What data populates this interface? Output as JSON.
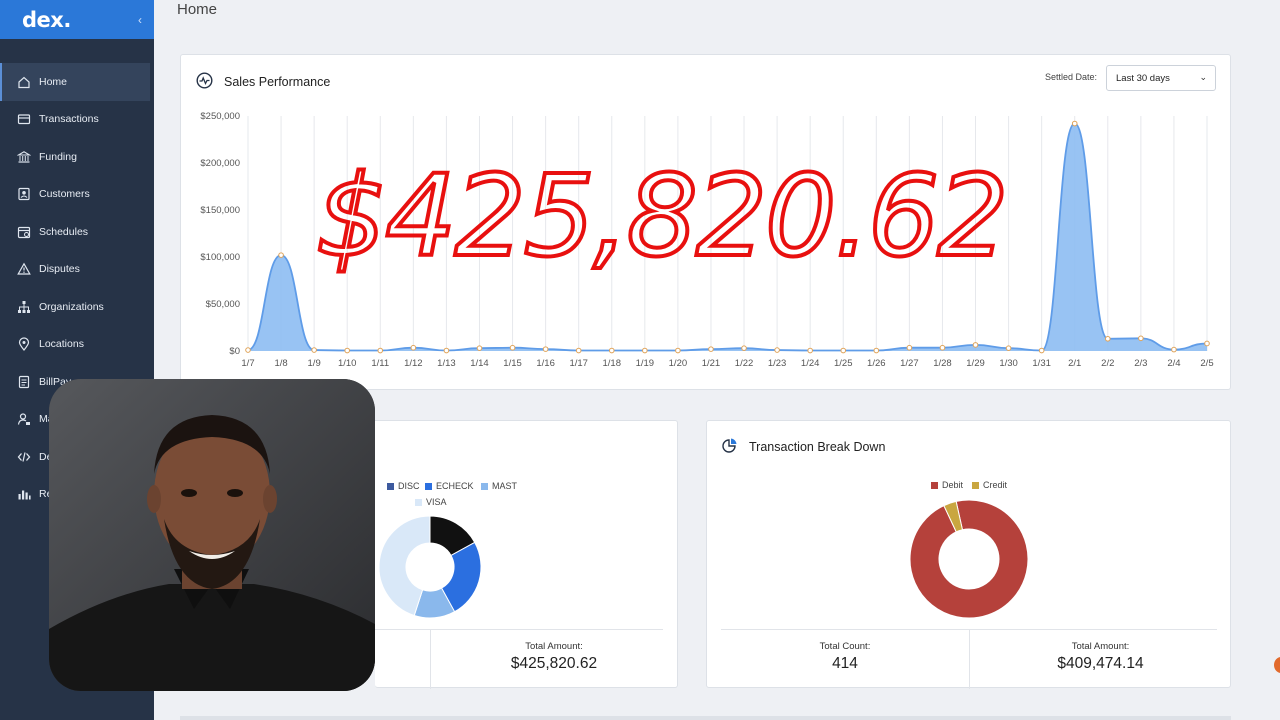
{
  "brand": {
    "logo": "dex.",
    "collapse_glyph": "‹"
  },
  "page": {
    "title": "Home"
  },
  "sidebar": {
    "items": [
      {
        "label": "Home",
        "icon": "home-icon",
        "active": true
      },
      {
        "label": "Transactions",
        "icon": "card-icon",
        "active": false
      },
      {
        "label": "Funding",
        "icon": "bank-icon",
        "active": false
      },
      {
        "label": "Customers",
        "icon": "contacts-icon",
        "active": false
      },
      {
        "label": "Schedules",
        "icon": "calendar-icon",
        "active": false
      },
      {
        "label": "Disputes",
        "icon": "warning-icon",
        "active": false
      },
      {
        "label": "Organizations",
        "icon": "sitemap-icon",
        "active": false
      },
      {
        "label": "Locations",
        "icon": "pin-icon",
        "active": false
      },
      {
        "label": "BillPay",
        "icon": "bill-icon",
        "active": false
      },
      {
        "label": "Ma",
        "icon": "user-lock-icon",
        "active": false
      },
      {
        "label": "De",
        "icon": "code-icon",
        "active": false
      },
      {
        "label": "Re",
        "icon": "bar-chart-icon",
        "active": false
      }
    ]
  },
  "sales": {
    "title": "Sales Performance",
    "filter_label": "Settled Date:",
    "filter_value": "Last 30 days",
    "annotation": "$425,820.62"
  },
  "payment": {
    "legend": [
      {
        "label": "X",
        "color": "#111111"
      },
      {
        "label": "DISC",
        "color": "#3d5a9e"
      },
      {
        "label": "ECHECK",
        "color": "#2b6fe0"
      },
      {
        "label": "MAST",
        "color": "#8ab8ec"
      },
      {
        "label": "VISA",
        "color": "#d9e8f8"
      }
    ],
    "total_amount_label": "Total Amount:",
    "total_amount_value": "$425,820.62"
  },
  "transactions": {
    "title": "Transaction Break Down",
    "legend": [
      {
        "label": "Debit",
        "color": "#b5413b"
      },
      {
        "label": "Credit",
        "color": "#c9a640"
      }
    ],
    "total_count_label": "Total Count:",
    "total_count_value": "414",
    "total_amount_label": "Total Amount:",
    "total_amount_value": "$409,474.14"
  },
  "chart_data": [
    {
      "type": "area",
      "title": "Sales Performance",
      "categories": [
        "1/7",
        "1/8",
        "1/9",
        "1/10",
        "1/11",
        "1/12",
        "1/13",
        "1/14",
        "1/15",
        "1/16",
        "1/17",
        "1/18",
        "1/19",
        "1/20",
        "1/21",
        "1/22",
        "1/23",
        "1/24",
        "1/25",
        "1/26",
        "1/27",
        "1/28",
        "1/29",
        "1/30",
        "1/31",
        "2/1",
        "2/2",
        "2/3",
        "2/4",
        "2/5"
      ],
      "values": [
        1000,
        102000,
        1000,
        500,
        500,
        3500,
        500,
        3000,
        3500,
        2000,
        500,
        500,
        500,
        500,
        2000,
        3000,
        1000,
        500,
        500,
        500,
        3500,
        3500,
        6500,
        3000,
        500,
        242000,
        13000,
        13500,
        1500,
        8000
      ],
      "ylim": [
        0,
        250000
      ],
      "yticks": [
        "$0",
        "$50,000",
        "$100,000",
        "$150,000",
        "$200,000",
        "$250,000"
      ],
      "color": "#7eb3f0",
      "grid": "vertical"
    },
    {
      "type": "pie",
      "title": "",
      "slices": [
        {
          "label": "X",
          "value": 17,
          "color": "#111111"
        },
        {
          "label": "ECHECK",
          "value": 25,
          "color": "#2b6fe0"
        },
        {
          "label": "MAST",
          "value": 13,
          "color": "#8ab8ec"
        },
        {
          "label": "VISA",
          "value": 45,
          "color": "#d9e8f8"
        }
      ]
    },
    {
      "type": "pie",
      "title": "",
      "slices": [
        {
          "label": "Debit",
          "value": 96.5,
          "color": "#b5413b"
        },
        {
          "label": "Credit",
          "value": 3.5,
          "color": "#c9a640"
        }
      ]
    }
  ]
}
